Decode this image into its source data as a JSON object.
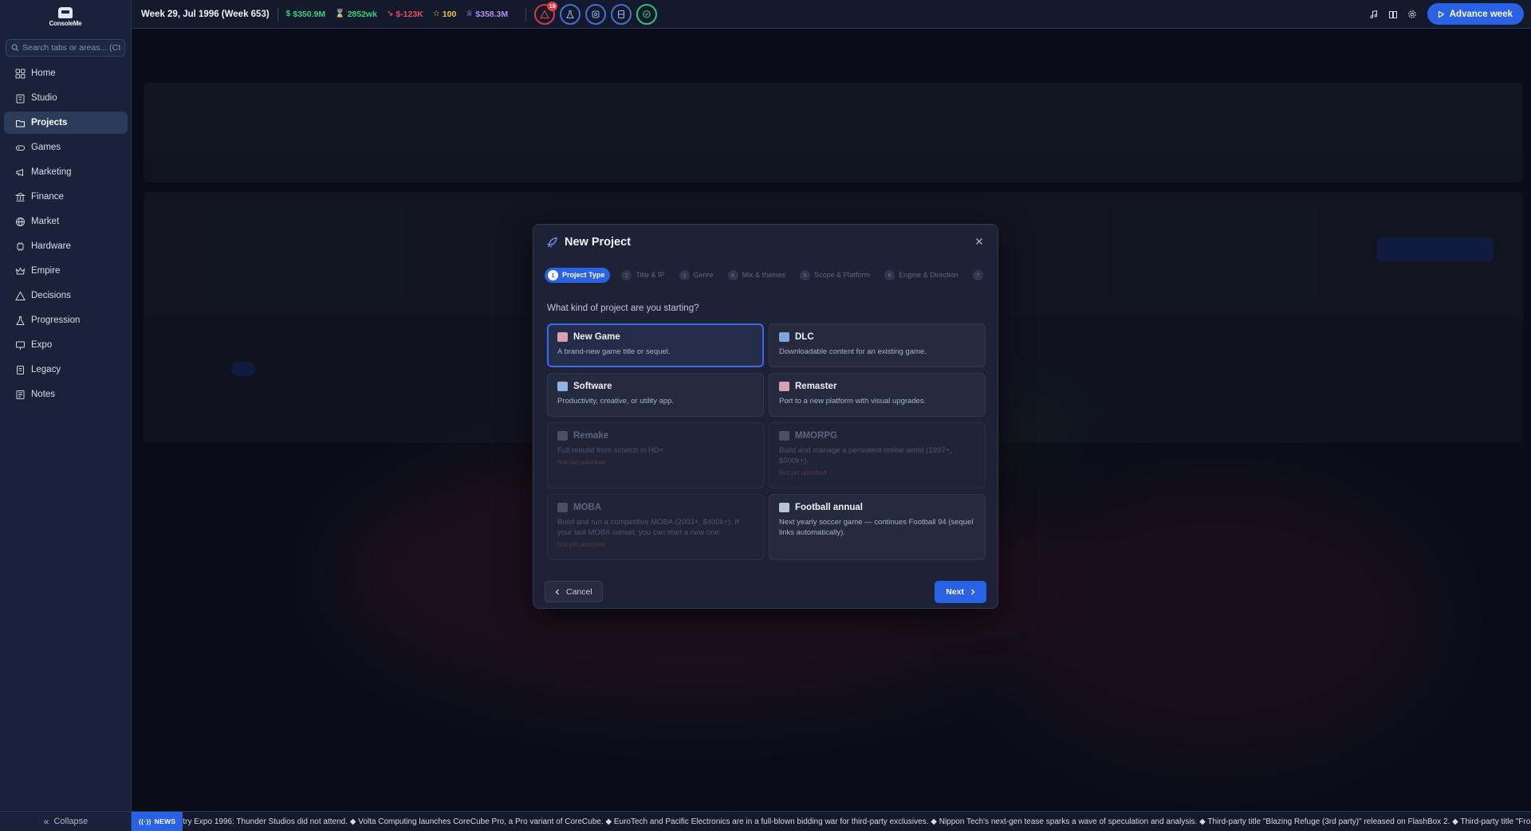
{
  "sidebar": {
    "logo_text": "ConsoleMe",
    "search_placeholder": "Search tabs or areas... (Ctrl+K)",
    "items": [
      {
        "label": "Home",
        "icon": "home-grid-icon"
      },
      {
        "label": "Studio",
        "icon": "building-icon"
      },
      {
        "label": "Projects",
        "icon": "folder-icon",
        "active": true
      },
      {
        "label": "Games",
        "icon": "gamepad-icon"
      },
      {
        "label": "Marketing",
        "icon": "megaphone-icon"
      },
      {
        "label": "Finance",
        "icon": "bank-icon"
      },
      {
        "label": "Market",
        "icon": "globe-icon"
      },
      {
        "label": "Hardware",
        "icon": "chip-icon"
      },
      {
        "label": "Empire",
        "icon": "crown-icon"
      },
      {
        "label": "Decisions",
        "icon": "alert-triangle-icon"
      },
      {
        "label": "Progression",
        "icon": "flask-icon"
      },
      {
        "label": "Expo",
        "icon": "presentation-icon"
      },
      {
        "label": "Legacy",
        "icon": "book-icon"
      },
      {
        "label": "Notes",
        "icon": "notes-icon"
      }
    ],
    "collapse_label": "Collapse"
  },
  "topbar": {
    "week": "Week 29, Jul 1996 (Week 653)",
    "stats": [
      {
        "icon": "$",
        "value": "$350.9M",
        "color": "#3bd07f"
      },
      {
        "icon": "⌛",
        "value": "2852wk",
        "color": "#3bd07f"
      },
      {
        "icon": "↘",
        "value": "$-123K",
        "color": "#ef4b57"
      },
      {
        "icon": "☆",
        "value": "100",
        "color": "#f4c43c"
      },
      {
        "icon": "♕",
        "value": "$358.3M",
        "color": "#b68bf0"
      }
    ],
    "alert_badge": "19",
    "advance_label": "Advance week"
  },
  "modal": {
    "title": "New Project",
    "steps": [
      {
        "num": "1",
        "label": "Project Type"
      },
      {
        "num": "2",
        "label": "Title & IP"
      },
      {
        "num": "3",
        "label": "Genre"
      },
      {
        "num": "4",
        "label": "Mix & themes"
      },
      {
        "num": "5",
        "label": "Scope & Platform"
      },
      {
        "num": "6",
        "label": "Engine & Direction"
      },
      {
        "num": "7",
        "label": ""
      }
    ],
    "question": "What kind of project are you starting?",
    "cards": [
      {
        "title": "New Game",
        "desc": "A brand-new game title or sequel.",
        "locked_text": ""
      },
      {
        "title": "DLC",
        "desc": "Downloadable content for an existing game.",
        "locked_text": ""
      },
      {
        "title": "Software",
        "desc": "Productivity, creative, or utility app.",
        "locked_text": ""
      },
      {
        "title": "Remaster",
        "desc": "Port to a new platform with visual upgrades.",
        "locked_text": ""
      },
      {
        "title": "Remake",
        "desc": "Full rebuild from scratch in HD+.",
        "locked_text": "Not yet unlocked"
      },
      {
        "title": "MMORPG",
        "desc": "Build and manage a persistent online world (1997+, $500k+).",
        "locked_text": "Not yet unlocked"
      },
      {
        "title": "MOBA",
        "desc": "Build and run a competitive MOBA (2003+, $400k+). If your last MOBA sunset, you can start a new one.",
        "locked_text": "Not yet unlocked"
      },
      {
        "title": "Football annual",
        "desc": "Next yearly soccer game — continues Football 94 (sequel links automatically).",
        "locked_text": ""
      }
    ],
    "cancel_label": "Cancel",
    "next_label": "Next"
  },
  "news": {
    "tag": "NEWS",
    "text": "try Expo 1996: Thunder Studios did not attend. ◆ Volta Computing launches CoreCube Pro, a Pro variant of CoreCube. ◆ EuroTech and Pacific Electronics are in a full-blown bidding war for third-party exclusives. ◆ Nippon Tech's next-gen tease sparks a wave of speculation and analysis. ◆ Third-party title \"Blazing Refuge (3rd party)\" released on FlashBox 2. ◆ Third-party title \"Frozen Moon"
  },
  "colors": {
    "accent": "#2a62e6",
    "sidebar_bg": "#192239",
    "modal_bg": "#1d2236",
    "positive": "#3bd07f",
    "negative": "#ef4b57"
  }
}
